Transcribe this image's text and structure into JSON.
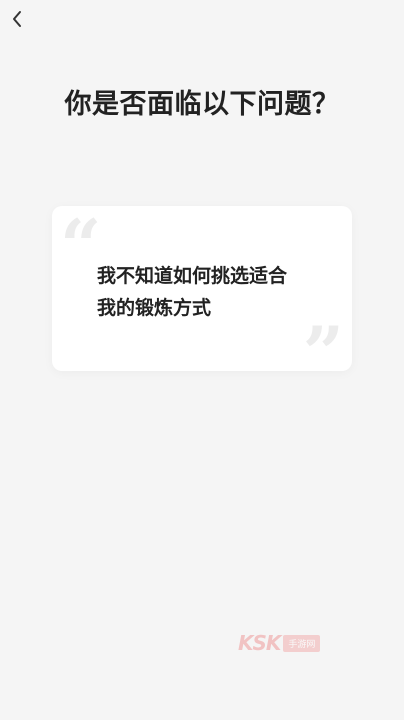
{
  "header": {
    "back_icon": "chevron-left-icon"
  },
  "title": "你是否面临以下问题？",
  "card": {
    "quote_open": "“",
    "quote_close": "”",
    "text_line1": "我不知道如何挑选适合",
    "text_line2": "我的锻炼方式"
  },
  "watermark": {
    "logo": "KSK",
    "tag": "手游网"
  }
}
